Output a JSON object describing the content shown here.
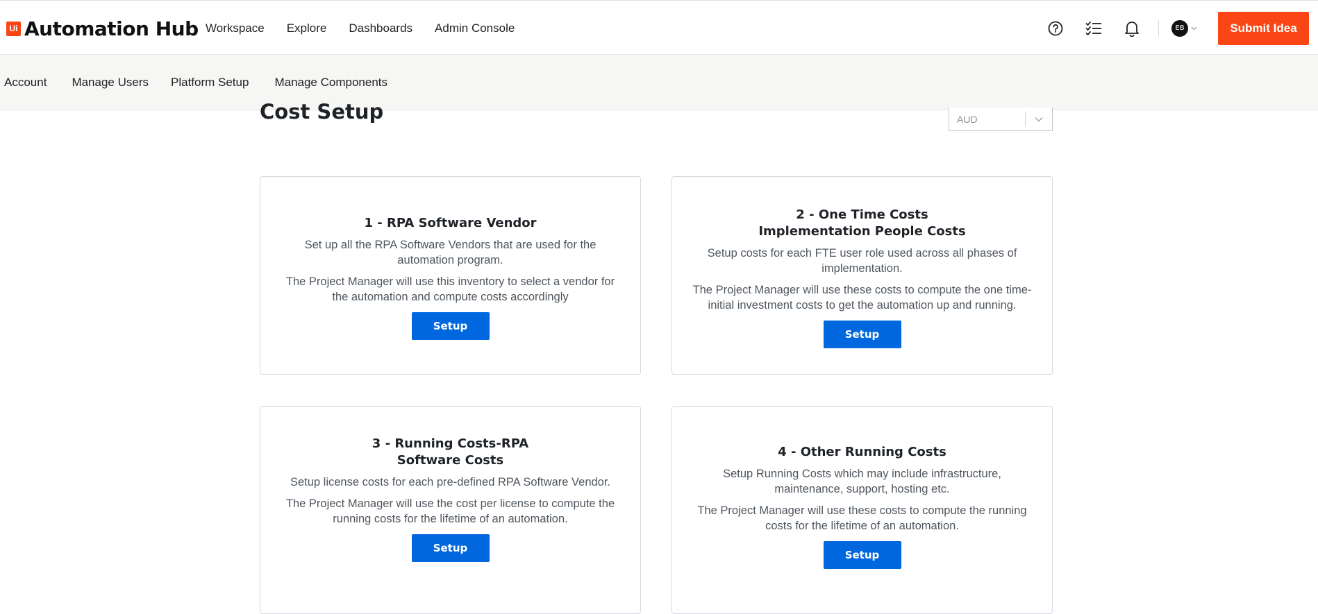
{
  "header": {
    "logo_mark": "Ui",
    "logo_text": "Automation Hub",
    "nav": [
      "Workspace",
      "Explore",
      "Dashboards",
      "Admin Console"
    ],
    "avatar_initials": "EB",
    "submit_label": "Submit Idea",
    "icons": [
      "help-icon",
      "tasks-checklist-icon",
      "bell-icon",
      "chevron-down-icon"
    ]
  },
  "subnav": [
    "Account",
    "Manage Users",
    "Platform Setup",
    "Manage Components"
  ],
  "page": {
    "title": "Cost Setup",
    "currency": "AUD"
  },
  "cards": [
    {
      "title_lines": [
        "1 - RPA Software Vendor"
      ],
      "paragraphs": [
        [
          "Set up all the RPA Software Vendors that are used for the",
          "automation program."
        ],
        [
          "The Project Manager will use this inventory to select a vendor for",
          "the automation and compute costs accordingly"
        ]
      ],
      "button": "Setup"
    },
    {
      "title_lines": [
        "2 - One Time Costs",
        "Implementation People Costs"
      ],
      "paragraphs": [
        [
          "Setup costs for each FTE user role used across all phases of",
          "implementation."
        ],
        [
          "The Project Manager will use these costs to compute the one time-",
          "initial investment costs to get the automation up and running."
        ]
      ],
      "button": "Setup"
    },
    {
      "title_lines": [
        "3 - Running Costs-RPA",
        "Software Costs"
      ],
      "paragraphs": [
        [
          "Setup license costs for each pre-defined RPA Software Vendor."
        ],
        [
          "The Project Manager will use the cost per license to compute the",
          "running costs for the lifetime of an automation."
        ]
      ],
      "button": "Setup"
    },
    {
      "title_lines": [
        "4 - Other Running Costs"
      ],
      "paragraphs": [
        [
          "Setup Running Costs which may include infrastructure,",
          "maintenance, support, hosting etc."
        ],
        [
          "The Project Manager will use these costs to compute the running",
          "costs for the lifetime of an automation."
        ]
      ],
      "button": "Setup"
    }
  ],
  "colors": {
    "brand_orange": "#fa4616",
    "primary_blue": "#0067df",
    "subnav_bg": "#f6f6f5"
  }
}
